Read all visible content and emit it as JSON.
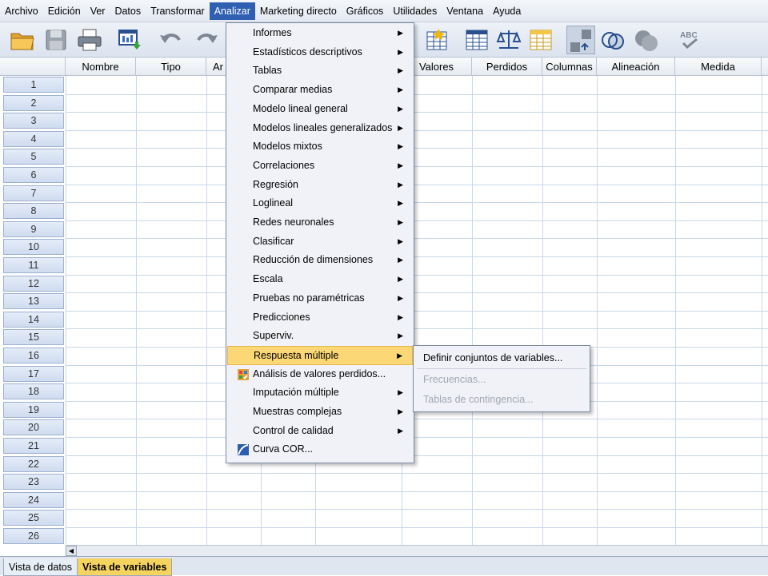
{
  "menubar": {
    "items": [
      "Archivo",
      "Edición",
      "Ver",
      "Datos",
      "Transformar",
      "Analizar",
      "Marketing directo",
      "Gráficos",
      "Utilidades",
      "Ventana",
      "Ayuda"
    ],
    "active_index": 5
  },
  "toolbar": {
    "icons": [
      "open-folder-icon",
      "save-icon",
      "print-icon",
      "dialog-recall-icon",
      "undo-icon",
      "redo-icon",
      "select-cases-icon",
      "insert-variable-icon",
      "weight-cases-icon",
      "split-file-icon",
      "value-labels-icon",
      "sets-icon",
      "use-sets-icon",
      "spell-check-icon"
    ],
    "spell_text": "ABC"
  },
  "grid": {
    "columns": [
      "Nombre",
      "Tipo",
      "Ar",
      "Valores",
      "Perdidos",
      "Columnas",
      "Alineación",
      "Medida"
    ],
    "rows": [
      "1",
      "2",
      "3",
      "4",
      "5",
      "6",
      "7",
      "8",
      "9",
      "10",
      "11",
      "12",
      "13",
      "14",
      "15",
      "16",
      "17",
      "18",
      "19",
      "20",
      "21",
      "22",
      "23",
      "24",
      "25",
      "26"
    ]
  },
  "analizar_menu": {
    "items": [
      {
        "label": "Informes",
        "submenu": true
      },
      {
        "label": "Estadísticos descriptivos",
        "submenu": true
      },
      {
        "label": "Tablas",
        "submenu": true
      },
      {
        "label": "Comparar medias",
        "submenu": true
      },
      {
        "label": "Modelo lineal general",
        "submenu": true
      },
      {
        "label": "Modelos lineales generalizados",
        "submenu": true
      },
      {
        "label": "Modelos mixtos",
        "submenu": true
      },
      {
        "label": "Correlaciones",
        "submenu": true
      },
      {
        "label": "Regresión",
        "submenu": true
      },
      {
        "label": "Loglineal",
        "submenu": true
      },
      {
        "label": "Redes neuronales",
        "submenu": true
      },
      {
        "label": "Clasificar",
        "submenu": true
      },
      {
        "label": "Reducción de dimensiones",
        "submenu": true
      },
      {
        "label": "Escala",
        "submenu": true
      },
      {
        "label": "Pruebas no paramétricas",
        "submenu": true
      },
      {
        "label": "Predicciones",
        "submenu": true
      },
      {
        "label": "Superviv.",
        "submenu": true
      },
      {
        "label": "Respuesta múltiple",
        "submenu": true
      },
      {
        "label": "Análisis de valores perdidos...",
        "submenu": false
      },
      {
        "label": "Imputación múltiple",
        "submenu": true
      },
      {
        "label": "Muestras complejas",
        "submenu": true
      },
      {
        "label": "Control de calidad",
        "submenu": true
      },
      {
        "label": "Curva COR...",
        "submenu": false
      }
    ],
    "highlight_index": 17,
    "arrow": "▶"
  },
  "respuesta_submenu": {
    "items": [
      {
        "label": "Definir conjuntos de variables...",
        "enabled": true
      },
      {
        "label": "Frecuencias...",
        "enabled": false
      },
      {
        "label": "Tablas de contingencia...",
        "enabled": false
      }
    ]
  },
  "bottom_tabs": {
    "data_view": "Vista de datos",
    "variable_view": "Vista de variables",
    "active": "variable_view"
  },
  "colors": {
    "menu_highlight": "#fbd775",
    "active_tab": "#f5d35f",
    "menubar_active": "#2f5fb1"
  }
}
